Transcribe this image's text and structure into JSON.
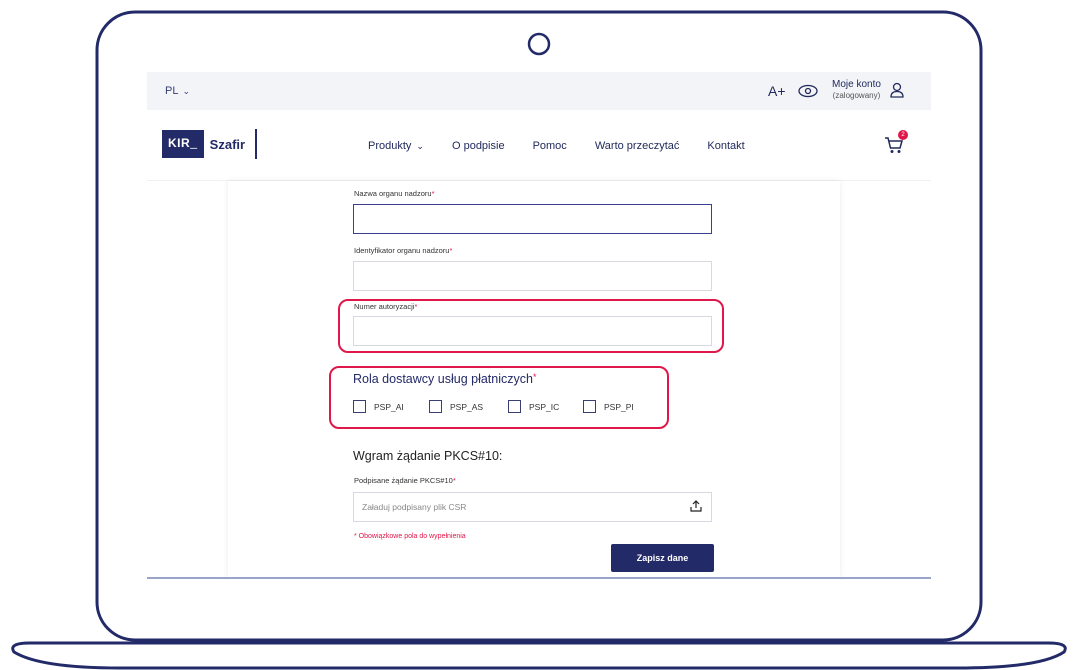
{
  "topbar": {
    "lang": "PL",
    "font_size": "A+",
    "account_label": "Moje konto",
    "account_status": "(zalogowany)"
  },
  "logo": {
    "kir": "KIR",
    "name": "Szafir"
  },
  "nav": {
    "items": [
      "Produkty",
      "O podpisie",
      "Pomoc",
      "Warto przeczytać",
      "Kontakt"
    ],
    "cart_count": "2"
  },
  "form": {
    "supervisor_name_label": "Nazwa organu nadzoru",
    "supervisor_id_label": "Identyfikator organu nadzoru",
    "auth_number_label": "Numer autoryzacji",
    "role_title": "Rola dostawcy usług płatniczych",
    "roles": [
      "PSP_AI",
      "PSP_AS",
      "PSP_IC",
      "PSP_PI"
    ],
    "pkcs_title": "Wgram żądanie PKCS#10:",
    "pkcs_label": "Podpisane żądanie PKCS#10",
    "upload_placeholder": "Załaduj podpisany plik CSR",
    "required_note": "* Obowiązkowe pola do wypełnienia",
    "save_button": "Zapisz dane",
    "required_mark": "*"
  },
  "colors": {
    "brand": "#232a68",
    "accent": "#e0174a"
  }
}
